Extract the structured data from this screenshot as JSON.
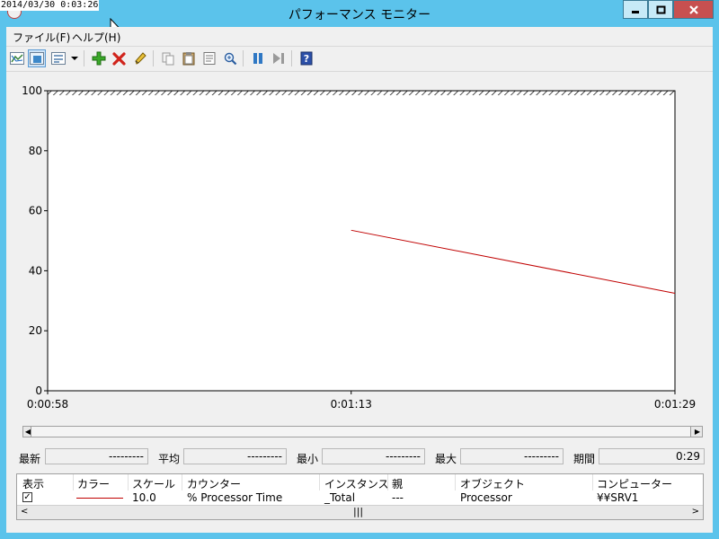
{
  "window": {
    "title": "パフォーマンス モニター",
    "timestamp": "2014/03/30 0:03:26"
  },
  "menu": {
    "items": [
      {
        "label": "ファイル(F)"
      },
      {
        "label": "ヘルプ(H)"
      }
    ]
  },
  "toolbar": {
    "icons": [
      "view-graph-icon",
      "view-histogram-icon",
      "view-report-icon",
      "dropdown-arrow-icon",
      "add-counter-icon",
      "delete-counter-icon",
      "highlight-icon",
      "copy-icon",
      "paste-icon",
      "properties-icon",
      "zoom-icon",
      "pause-icon",
      "next-frame-icon",
      "help-icon"
    ],
    "active_view": "view-histogram-icon"
  },
  "chart_data": {
    "type": "line",
    "y_ticks": [
      "100",
      "80",
      "60",
      "40",
      "20",
      "0"
    ],
    "ylim": [
      0,
      100
    ],
    "x_ticks": [
      "0:00:58",
      "0:01:13",
      "0:01:29"
    ],
    "xlim": [
      "0:00:58",
      "0:01:29"
    ],
    "grid": false,
    "series": [
      {
        "color": "#c00000",
        "x": [
          "0:01:13",
          "0:01:29"
        ],
        "y": [
          53.5,
          32.5
        ]
      }
    ]
  },
  "stats": {
    "latest": {
      "label": "最新",
      "value": "---------"
    },
    "average": {
      "label": "平均",
      "value": "---------"
    },
    "minimum": {
      "label": "最小",
      "value": "---------"
    },
    "maximum": {
      "label": "最大",
      "value": "---------"
    },
    "duration": {
      "label": "期間",
      "value": "0:29"
    }
  },
  "legend": {
    "columns": [
      "表示",
      "カラー",
      "スケール",
      "カウンター",
      "インスタンス",
      "親",
      "オブジェクト",
      "コンピューター"
    ],
    "rows": [
      {
        "show": true,
        "color": "#c00000",
        "scale": "10.0",
        "counter": "% Processor Time",
        "instance": "_Total",
        "parent": "---",
        "object": "Processor",
        "computer": "¥¥SRV1"
      }
    ]
  },
  "colors": {
    "title_bar": "#5bc3eb",
    "close_button": "#c75050",
    "series_line": "#c00000"
  }
}
